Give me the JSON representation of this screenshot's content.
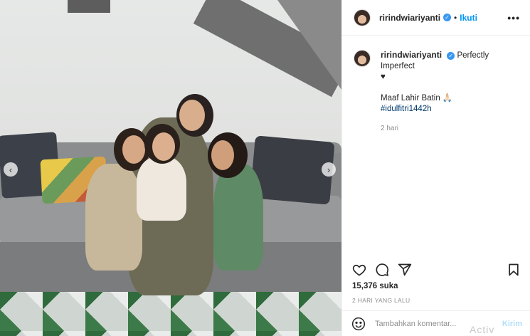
{
  "header": {
    "username": "ririndwiariyanti",
    "separator": "•",
    "follow_label": "Ikuti",
    "more_icon": "more-horizontal-icon",
    "more_label": "•••"
  },
  "caption": {
    "username": "ririndwiariyanti",
    "text_line1": "Perfectly Imperfect",
    "text_line2": "♥",
    "text_line3": "Maaf Lahir Batin 🙏🏻",
    "hashtag": "#idulfitri1442h",
    "time": "2 hari"
  },
  "carousel": {
    "prev_label": "‹",
    "next_label": "›"
  },
  "actions": {
    "like_icon": "heart-icon",
    "comment_icon": "comment-icon",
    "share_icon": "share-icon",
    "save_icon": "bookmark-icon"
  },
  "likes": "15,376 suka",
  "post_time": "2 HARI YANG LALU",
  "comment": {
    "placeholder": "Tambahkan komentar...",
    "post_label": "Kirim",
    "emoji_icon": "emoji-icon"
  },
  "watermark": "Activ",
  "colors": {
    "accent": "#0095f6",
    "verified": "#3897f0",
    "muted": "#8e8e8e",
    "post_disabled": "#b2dffc"
  }
}
